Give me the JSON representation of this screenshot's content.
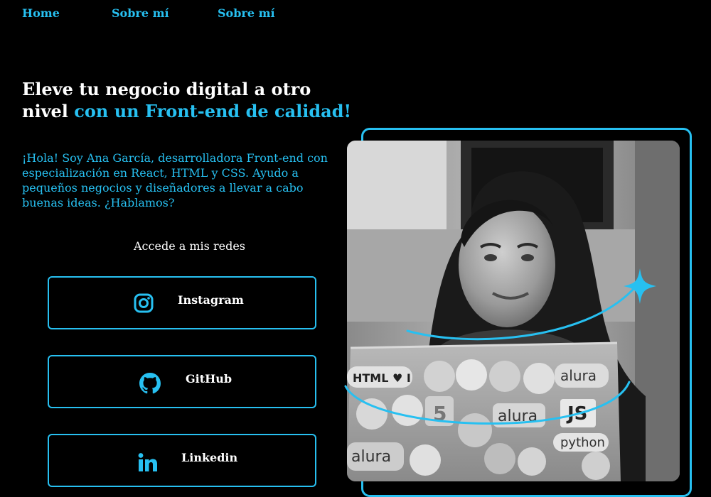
{
  "nav": {
    "items": [
      {
        "label": "Home"
      },
      {
        "label": "Sobre mí"
      },
      {
        "label": "Sobre mí"
      }
    ]
  },
  "hero": {
    "headline_part1": "Eleve tu negocio digital a otro nivel ",
    "headline_part2": "con un Front-end de calidad!",
    "bio": "¡Hola! Soy Ana García, desarrolladora Front-end con especialización en React, HTML y CSS. Ayudo a pequeños negocios y diseñadores a llevar a cabo buenas ideas. ¿Hablamos?",
    "networks_title": "Accede a mis redes"
  },
  "social": [
    {
      "label": "Instagram",
      "icon": "instagram-icon"
    },
    {
      "label": "GitHub",
      "icon": "github-icon"
    },
    {
      "label": "Linkedin",
      "icon": "linkedin-icon"
    }
  ],
  "laptop_stickers": {
    "html_sticker": "HTML ♥ I",
    "js_sticker": "JS",
    "alura_1": "alura",
    "alura_2": "alura",
    "alura_3": "alura",
    "python": "python",
    "html5": "5"
  },
  "colors": {
    "accent": "#27c0f1",
    "background": "#000000",
    "text": "#ffffff"
  }
}
